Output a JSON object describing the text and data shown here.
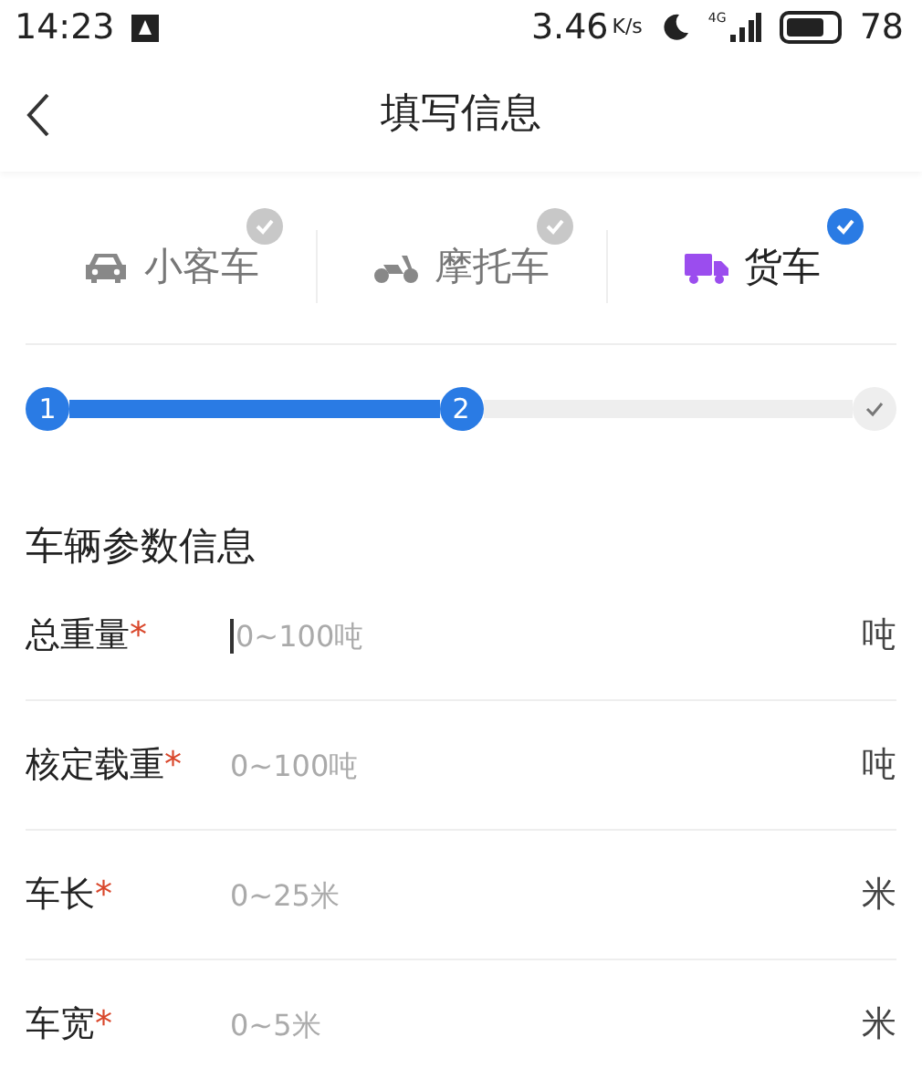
{
  "status_bar": {
    "time": "14:23",
    "speed": "3.46",
    "speed_unit": "K/s",
    "network": "4G",
    "battery": "78"
  },
  "header": {
    "title": "填写信息"
  },
  "vehicle_tabs": [
    {
      "label": "小客车",
      "kind": "car",
      "selected": false
    },
    {
      "label": "摩托车",
      "kind": "motorcycle",
      "selected": false
    },
    {
      "label": "货车",
      "kind": "truck",
      "selected": true
    }
  ],
  "stepper": {
    "steps": [
      {
        "label": "1",
        "done": true
      },
      {
        "label": "2",
        "done": true
      },
      {
        "kind": "check",
        "done": false
      }
    ]
  },
  "section_title": "车辆参数信息",
  "fields": [
    {
      "label": "总重量",
      "required_mark": "*",
      "placeholder": "0~100吨",
      "unit": "吨",
      "focused": true
    },
    {
      "label": "核定载重",
      "required_mark": "*",
      "placeholder": "0~100吨",
      "unit": "吨",
      "focused": false
    },
    {
      "label": "车长",
      "required_mark": "*",
      "placeholder": "0~25米",
      "unit": "米",
      "focused": false
    },
    {
      "label": "车宽",
      "required_mark": "*",
      "placeholder": "0~5米",
      "unit": "米",
      "focused": false
    }
  ]
}
